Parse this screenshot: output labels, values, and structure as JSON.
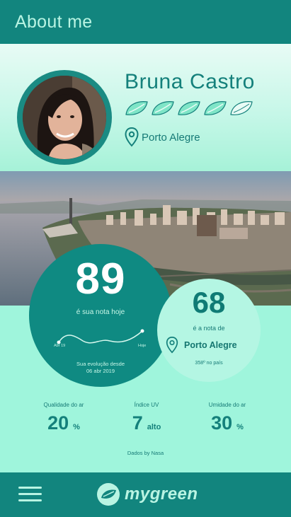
{
  "header": {
    "title": "About me"
  },
  "profile": {
    "name": "Bruna Castro",
    "rating_leaves_filled": 4,
    "rating_leaves_total": 5,
    "location": "Porto Alegre"
  },
  "score": {
    "value": "89",
    "caption": "é sua nota hoje",
    "trend_start_label": "Abr 19",
    "trend_end_label": "Hoje",
    "evolution_line1": "Sua evolução desde",
    "evolution_line2": "06 abr 2019"
  },
  "city_score": {
    "value": "68",
    "caption": "é a nota de",
    "city": "Porto Alegre",
    "rank": "358º no país"
  },
  "metrics": [
    {
      "label": "Qualidade do ar",
      "value": "20",
      "unit": "%"
    },
    {
      "label": "Índice UV",
      "value": "7",
      "unit": "alto"
    },
    {
      "label": "Umidade do ar",
      "value": "30",
      "unit": "%"
    }
  ],
  "source": "Dados by Nasa",
  "footer": {
    "logo_text": "mygreen"
  },
  "colors": {
    "primary": "#12857e",
    "accent_text": "#b9f4e3",
    "background": "#9ff5dc",
    "score_circle": "#0f8a82",
    "city_circle": "#b4f6e3"
  },
  "icons": {
    "location": "map-pin-icon",
    "leaf": "leaf-icon",
    "menu": "hamburger-menu-icon",
    "logo": "leaf-logo-icon"
  }
}
